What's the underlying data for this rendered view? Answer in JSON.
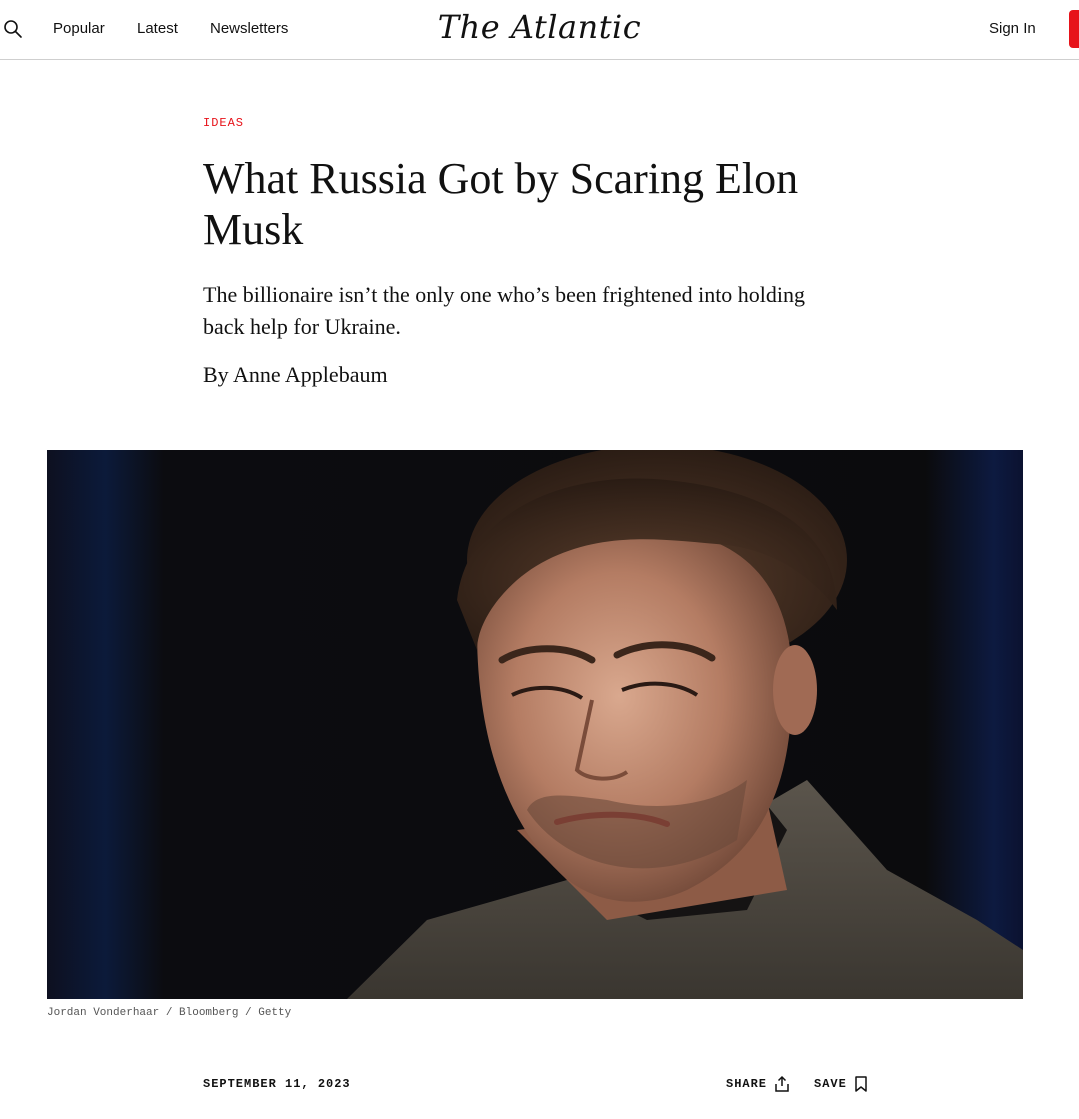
{
  "header": {
    "nav": [
      "Popular",
      "Latest",
      "Newsletters"
    ],
    "logo": "The Atlantic",
    "sign_in": "Sign In"
  },
  "article": {
    "section": "IDEAS",
    "headline_line1": "What Russia Got by Scaring Elon",
    "headline_line2": "Musk",
    "dek_line1": "The billionaire isn’t the only one who’s been frightened into holding",
    "dek_line2": "back help for Ukraine.",
    "byline_prefix": "By",
    "author": "Anne Applebaum",
    "image_credit": "Jordan Vonderhaar / Bloomberg / Getty",
    "date": "SEPTEMBER 11, 2023"
  },
  "actions": {
    "share": "SHARE",
    "save": "SAVE"
  },
  "colors": {
    "accent": "#e7131a",
    "text": "#111111",
    "credit": "#555555"
  },
  "icons": {
    "search": "search-icon",
    "share": "share-icon",
    "save": "bookmark-icon"
  }
}
